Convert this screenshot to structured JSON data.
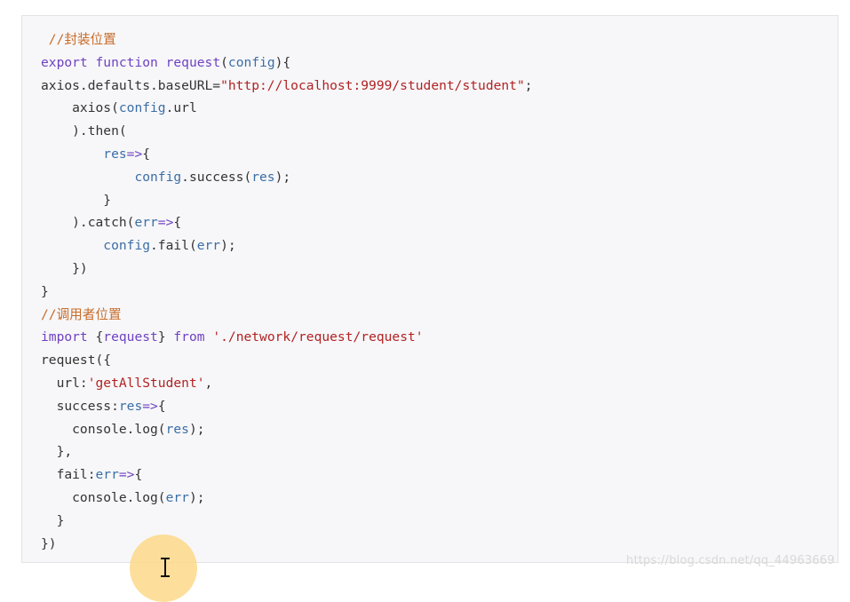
{
  "code_lines": [
    [
      {
        "t": " //封装位置",
        "k": "comment"
      }
    ],
    [
      {
        "t": "export",
        "k": "keyword"
      },
      {
        "t": " ",
        "k": "plain"
      },
      {
        "t": "function",
        "k": "keyword"
      },
      {
        "t": " ",
        "k": "plain"
      },
      {
        "t": "request",
        "k": "keyword"
      },
      {
        "t": "(",
        "k": "plain"
      },
      {
        "t": "config",
        "k": "ident"
      },
      {
        "t": "){",
        "k": "plain"
      }
    ],
    [
      {
        "t": "axios.defaults.baseURL=",
        "k": "plain"
      },
      {
        "t": "\"http://localhost:9999/student/student\"",
        "k": "string"
      },
      {
        "t": ";",
        "k": "plain"
      }
    ],
    [
      {
        "t": "    axios(",
        "k": "plain"
      },
      {
        "t": "config",
        "k": "ident"
      },
      {
        "t": ".url",
        "k": "plain"
      }
    ],
    [
      {
        "t": "    ).then(",
        "k": "plain"
      }
    ],
    [
      {
        "t": "        ",
        "k": "plain"
      },
      {
        "t": "res",
        "k": "ident"
      },
      {
        "t": "=>",
        "k": "keyword"
      },
      {
        "t": "{",
        "k": "plain"
      }
    ],
    [
      {
        "t": "            ",
        "k": "plain"
      },
      {
        "t": "config",
        "k": "ident"
      },
      {
        "t": ".success(",
        "k": "plain"
      },
      {
        "t": "res",
        "k": "ident"
      },
      {
        "t": ");",
        "k": "plain"
      }
    ],
    [
      {
        "t": "        }",
        "k": "plain"
      }
    ],
    [
      {
        "t": "    ).catch(",
        "k": "plain"
      },
      {
        "t": "err",
        "k": "ident"
      },
      {
        "t": "=>",
        "k": "keyword"
      },
      {
        "t": "{",
        "k": "plain"
      }
    ],
    [
      {
        "t": "        ",
        "k": "plain"
      },
      {
        "t": "config",
        "k": "ident"
      },
      {
        "t": ".fail(",
        "k": "plain"
      },
      {
        "t": "err",
        "k": "ident"
      },
      {
        "t": ");",
        "k": "plain"
      }
    ],
    [
      {
        "t": "    })",
        "k": "plain"
      }
    ],
    [
      {
        "t": "}",
        "k": "plain"
      }
    ],
    [
      {
        "t": "//调用者位置",
        "k": "comment"
      }
    ],
    [
      {
        "t": "import",
        "k": "keyword"
      },
      {
        "t": " {",
        "k": "plain"
      },
      {
        "t": "request",
        "k": "keyword"
      },
      {
        "t": "} ",
        "k": "plain"
      },
      {
        "t": "from",
        "k": "keyword"
      },
      {
        "t": " ",
        "k": "plain"
      },
      {
        "t": "'./network/request/request'",
        "k": "string"
      }
    ],
    [
      {
        "t": "request({",
        "k": "plain"
      }
    ],
    [
      {
        "t": "  url:",
        "k": "plain"
      },
      {
        "t": "'getAllStudent'",
        "k": "string"
      },
      {
        "t": ",",
        "k": "plain"
      }
    ],
    [
      {
        "t": "  success:",
        "k": "plain"
      },
      {
        "t": "res",
        "k": "ident"
      },
      {
        "t": "=>",
        "k": "keyword"
      },
      {
        "t": "{",
        "k": "plain"
      }
    ],
    [
      {
        "t": "    console.log(",
        "k": "plain"
      },
      {
        "t": "res",
        "k": "ident"
      },
      {
        "t": ");",
        "k": "plain"
      }
    ],
    [
      {
        "t": "  },",
        "k": "plain"
      }
    ],
    [
      {
        "t": "  fail:",
        "k": "plain"
      },
      {
        "t": "err",
        "k": "ident"
      },
      {
        "t": "=>",
        "k": "keyword"
      },
      {
        "t": "{",
        "k": "plain"
      }
    ],
    [
      {
        "t": "    console.log(",
        "k": "plain"
      },
      {
        "t": "err",
        "k": "ident"
      },
      {
        "t": ");",
        "k": "plain"
      }
    ],
    [
      {
        "t": "  }",
        "k": "plain"
      }
    ],
    [
      {
        "t": "})",
        "k": "plain"
      }
    ]
  ],
  "watermark": "https://blog.csdn.net/qq_44963669",
  "colors": {
    "keyword": "#6f42c1",
    "comment": "#c76b29",
    "string": "#b22222",
    "ident": "#3b6ea5",
    "plain": "#333333",
    "code_background": "#f7f7f9",
    "cursor_halo": "#fdd98a"
  },
  "icons": {
    "cursor": "text-cursor-icon",
    "highlight": "cursor-highlight-icon"
  }
}
